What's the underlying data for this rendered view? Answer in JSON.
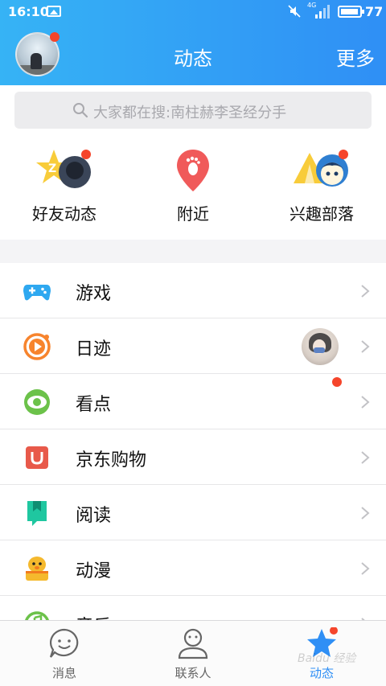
{
  "status_bar": {
    "time": "16:10",
    "network": "4G",
    "battery": "77"
  },
  "header": {
    "title": "动态",
    "more_label": "更多"
  },
  "search": {
    "placeholder": "大家都在搜:南柱赫李圣经分手"
  },
  "shortcuts": [
    {
      "label": "好友动态",
      "icon": "friends-feed-icon",
      "badge": true
    },
    {
      "label": "附近",
      "icon": "location-pin-icon",
      "badge": false
    },
    {
      "label": "兴趣部落",
      "icon": "tribe-icon",
      "badge": true
    }
  ],
  "list": [
    {
      "label": "游戏",
      "icon": "gamepad-icon",
      "color": "#2ea8f0"
    },
    {
      "label": "日迹",
      "icon": "daily-trace-icon",
      "color": "#f7842d",
      "has_avatar": true
    },
    {
      "label": "看点",
      "icon": "eye-icon",
      "color": "#6cc24a"
    },
    {
      "label": "京东购物",
      "icon": "shopping-bag-icon",
      "color": "#e8594a"
    },
    {
      "label": "阅读",
      "icon": "book-icon",
      "color": "#1fc7a0"
    },
    {
      "label": "动漫",
      "icon": "anime-icon",
      "color": "#f5b92d"
    },
    {
      "label": "音乐",
      "icon": "music-icon",
      "color": "#6cc24a"
    }
  ],
  "tabbar": [
    {
      "label": "消息",
      "icon": "message-icon",
      "active": false
    },
    {
      "label": "联系人",
      "icon": "contacts-icon",
      "active": false
    },
    {
      "label": "动态",
      "icon": "star-icon",
      "active": true
    }
  ],
  "watermark": "Baidu 经验",
  "colors": {
    "accent": "#2f8ff5",
    "badge": "#f5452b",
    "header_gradient_start": "#36b3f5"
  }
}
